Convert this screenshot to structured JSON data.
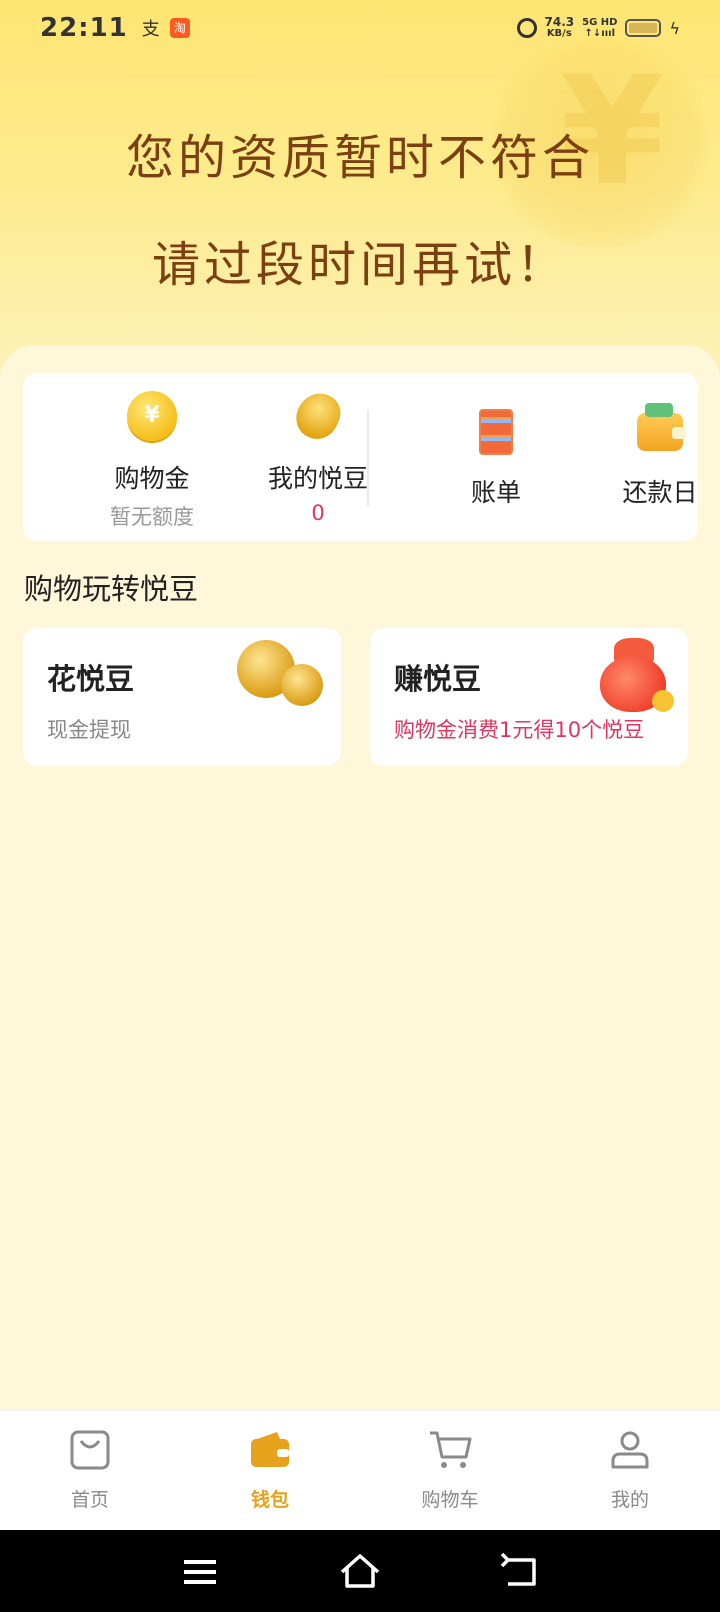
{
  "status_bar": {
    "time": "22:11",
    "app_icon_1": "支",
    "app_icon_2": "淘",
    "speed_value": "74.3",
    "speed_unit": "KB/s",
    "network_top": "5G HD",
    "network_bottom": "↑↓ıııl"
  },
  "hero": {
    "line1": "您的资质暂时不符合",
    "line2": "请过段时间再试！",
    "coin_symbol": "¥"
  },
  "quick_actions": [
    {
      "label": "购物金",
      "sub": "暂无额度",
      "icon": "coin-icon"
    },
    {
      "label": "我的悦豆",
      "sub": "0",
      "icon": "bean-icon"
    },
    {
      "label": "账单",
      "icon": "bill-icon"
    },
    {
      "label": "还款日",
      "icon": "wallet-icon"
    }
  ],
  "section": {
    "title": "购物玩转悦豆"
  },
  "cards": [
    {
      "title": "花悦豆",
      "subtitle": "现金提现",
      "icon": "beans-icon"
    },
    {
      "title": "赚悦豆",
      "subtitle": "购物金消费1元得10个悦豆",
      "icon": "lucky-bag-icon"
    }
  ],
  "bottom_nav": [
    {
      "label": "首页",
      "icon": "shopping-bag-icon",
      "active": false
    },
    {
      "label": "钱包",
      "icon": "wallet-icon",
      "active": true
    },
    {
      "label": "购物车",
      "icon": "cart-icon",
      "active": false
    },
    {
      "label": "我的",
      "icon": "user-icon",
      "active": false
    }
  ],
  "colors": {
    "accent": "#e6a21c",
    "hero_text": "#7c3f12",
    "highlight_red": "#e0355f"
  }
}
